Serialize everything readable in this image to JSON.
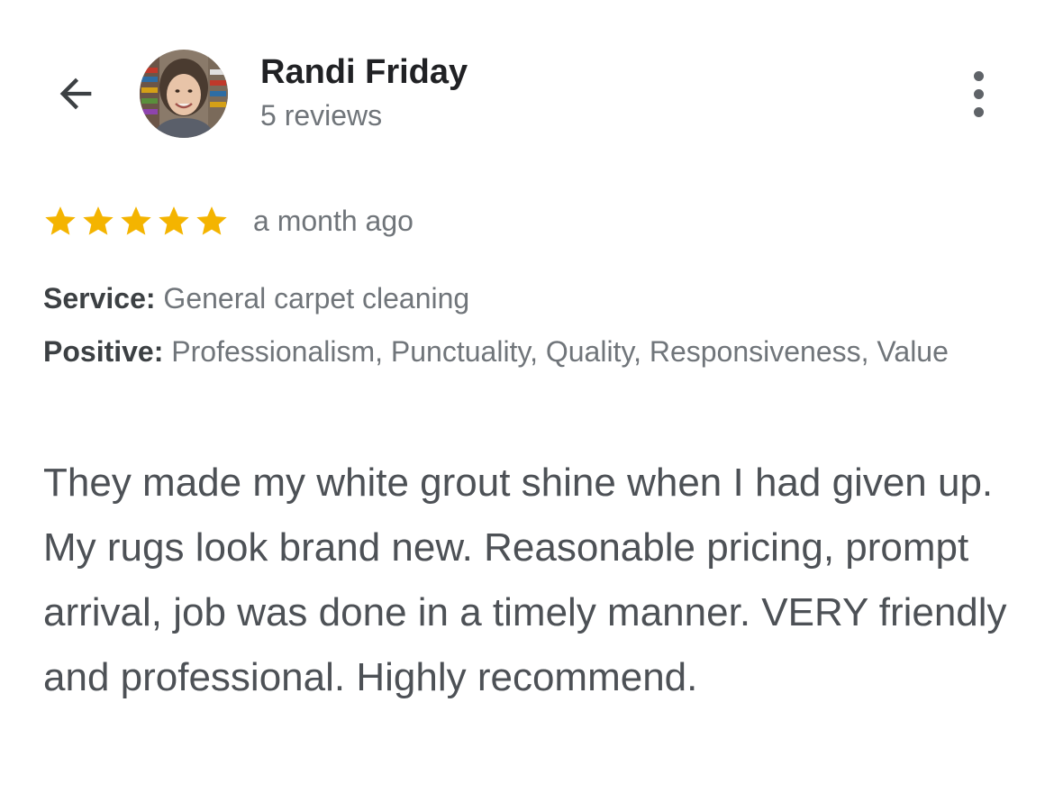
{
  "header": {
    "back_icon": "arrow-left-icon",
    "reviewer_name": "Randi Friday",
    "review_count": "5 reviews",
    "more_icon": "more-vertical-icon"
  },
  "review": {
    "rating": 5,
    "rating_max": 5,
    "star_color": "#F4B400",
    "date": "a month ago",
    "service_label": "Service:",
    "service_value": "General carpet cleaning",
    "positive_label": "Positive:",
    "positive_value": "Professionalism, Punctuality, Quality, Responsiveness, Value",
    "text": "They made my white grout shine when I had given up. My rugs look brand new. Reasonable pricing, prompt arrival, job was done in a timely manner. VERY friendly and professional. Highly recommend."
  }
}
